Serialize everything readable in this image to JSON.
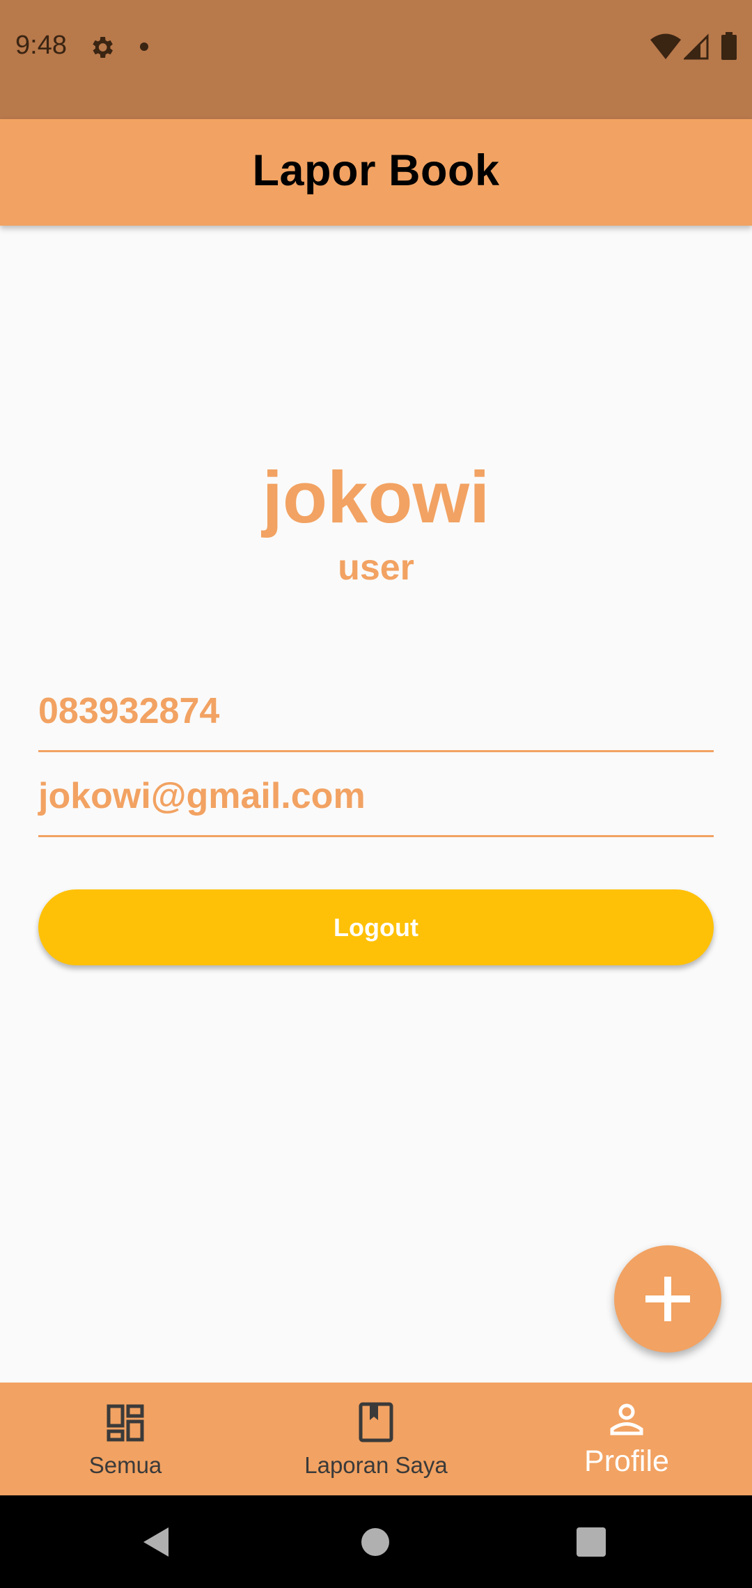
{
  "status_bar": {
    "time": "9:48",
    "icons": [
      "gear-icon",
      "dot-icon",
      "wifi-icon",
      "signal-icon",
      "battery-icon"
    ],
    "background_color": "#b8794b"
  },
  "app_bar": {
    "title": "Lapor Book",
    "background_color": "#f2a262"
  },
  "profile": {
    "name": "jokowi",
    "role": "user",
    "phone": "083932874",
    "email": "jokowi@gmail.com",
    "accent_color": "#f2a262"
  },
  "logout_button": {
    "label": "Logout",
    "color": "#ffc107"
  },
  "fab": {
    "icon": "plus-icon"
  },
  "bottom_nav": {
    "items": [
      {
        "label": "Semua",
        "icon": "dashboard-icon",
        "active": false
      },
      {
        "label": "Laporan Saya",
        "icon": "book-icon",
        "active": false
      },
      {
        "label": "Profile",
        "icon": "person-icon",
        "active": true
      }
    ]
  },
  "system_nav": {
    "buttons": [
      "back-icon",
      "home-icon",
      "recents-icon"
    ]
  }
}
